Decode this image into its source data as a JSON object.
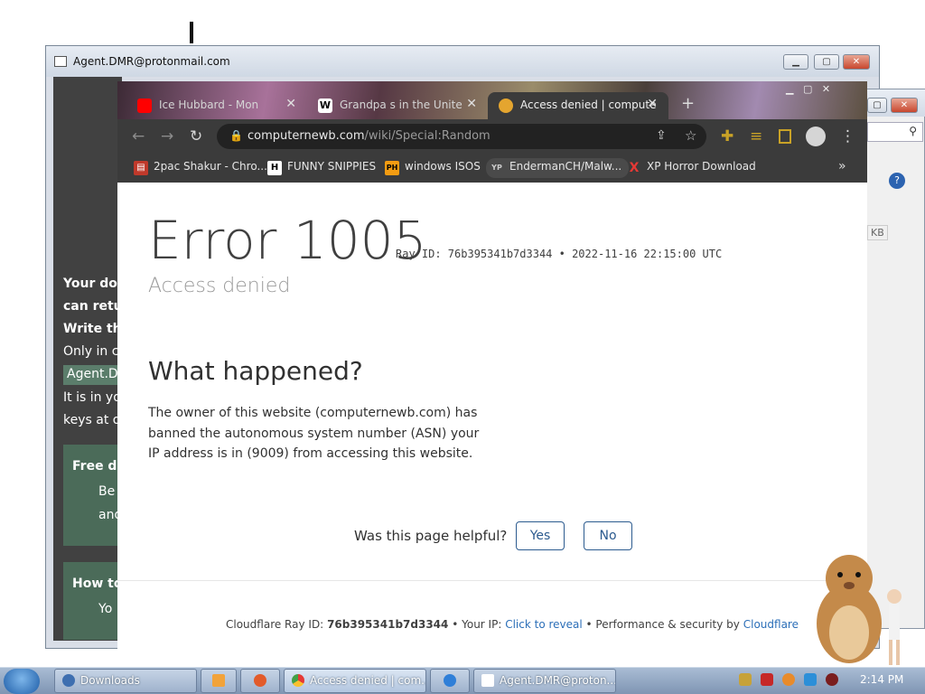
{
  "background_window": {
    "title": "Agent.DMR@protonmail.com",
    "lines": [
      {
        "text": "Your do",
        "bold": true
      },
      {
        "text": "can retu",
        "bold": true
      },
      {
        "text": "Write th",
        "bold": true
      },
      {
        "text": "Only in ca",
        "bold": false
      }
    ],
    "email_pill": "Agent.D",
    "line_after_1": "It is in yo",
    "line_after_2": "keys at o",
    "box1_title": "Free d",
    "box1_line1": "Be",
    "box1_line2": "and",
    "box2_title": "How to",
    "box2_line1": "Yo"
  },
  "right_window": {
    "size_label": "KB"
  },
  "chrome": {
    "tabs": [
      {
        "label": "Ice Hubbard - Mon",
        "icon": "youtube-icon",
        "color": "#ff0000"
      },
      {
        "label": "Grandpa s in the Unite",
        "icon": "wikipedia-icon",
        "color": "#ffffff"
      },
      {
        "label": "Access denied | compute",
        "icon": "cloudflare-icon",
        "color": "#e4a52f"
      }
    ],
    "new_tab": "+",
    "url": {
      "host": "computernewb.com",
      "path": "/wiki/Special:Random"
    },
    "bookmarks": [
      {
        "label": "2pac Shakur - Chro...",
        "icon": "folder-icon",
        "glyph": "▤",
        "bg": "#c0392b"
      },
      {
        "label": "FUNNY SNIPPIES",
        "icon": "h-icon",
        "glyph": "H",
        "bg": "#ffffff"
      },
      {
        "label": "windows ISOS",
        "icon": "ph-icon",
        "glyph": "PH",
        "bg": "#f39c12"
      },
      {
        "label": "EndermanCH/Malw...",
        "icon": "yp-icon",
        "glyph": "YP",
        "bg": "#2b2b2b"
      },
      {
        "label": "XP Horror Download",
        "icon": "x-icon",
        "glyph": "X",
        "bg": "#3b3b3b"
      }
    ],
    "overflow": "»"
  },
  "error_page": {
    "title": "Error 1005",
    "ray_line": "Ray ID: 76b395341b7d3344 • 2022-11-16 22:15:00 UTC",
    "subtitle": "Access denied",
    "what_happened": "What happened?",
    "explanation": "The owner of this website (computernewb.com) has banned the autonomous system number (ASN) your IP address is in (9009) from accessing this website.",
    "helpful_q": "Was this page helpful?",
    "yes": "Yes",
    "no": "No",
    "footer": {
      "ray_label": "Cloudflare Ray ID:",
      "ray_id": "76b395341b7d3344",
      "ip_label": "• Your IP:",
      "reveal": "Click to reveal",
      "perf": "• Performance & security by",
      "cloudflare": "Cloudflare"
    }
  },
  "taskbar": {
    "items": [
      {
        "label": "Downloads",
        "icon": "downloads-icon",
        "color": "#3e6fb0"
      },
      {
        "label": "",
        "icon": "media-player-icon",
        "color": "#f2a33a"
      },
      {
        "label": "",
        "icon": "app-icon",
        "color": "#e25b2b"
      },
      {
        "label": "Access denied | com...",
        "icon": "chrome-icon",
        "color": "#4caf50"
      },
      {
        "label": "",
        "icon": "ie-icon",
        "color": "#2f7fd8"
      },
      {
        "label": "Agent.DMR@proton...",
        "icon": "window-icon",
        "color": "#ffffff"
      }
    ],
    "clock": "2:14 PM"
  }
}
